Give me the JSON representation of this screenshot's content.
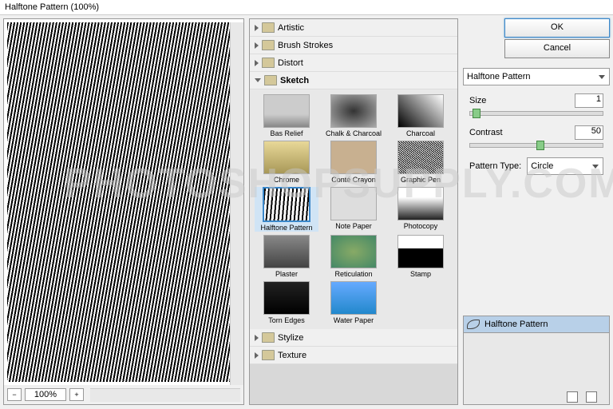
{
  "window_title": "Halftone Pattern (100%)",
  "zoom": "100%",
  "categories": {
    "artistic": "Artistic",
    "brush": "Brush Strokes",
    "distort": "Distort",
    "sketch": "Sketch",
    "stylize": "Stylize",
    "texture": "Texture"
  },
  "sketch_thumbs": [
    "Bas Relief",
    "Chalk & Charcoal",
    "Charcoal",
    "Chrome",
    "Conté Crayon",
    "Graphic Pen",
    "Halftone Pattern",
    "Note Paper",
    "Photocopy",
    "Plaster",
    "Reticulation",
    "Stamp",
    "Torn Edges",
    "Water Paper"
  ],
  "settings": {
    "ok": "OK",
    "cancel": "Cancel",
    "filter_name": "Halftone Pattern",
    "size_label": "Size",
    "size_val": "1",
    "contrast_label": "Contrast",
    "contrast_val": "50",
    "pattern_label": "Pattern Type:",
    "pattern_val": "Circle"
  },
  "layer": "Halftone Pattern",
  "watermark": "PHOTOSHOPSUPPLY.COM"
}
